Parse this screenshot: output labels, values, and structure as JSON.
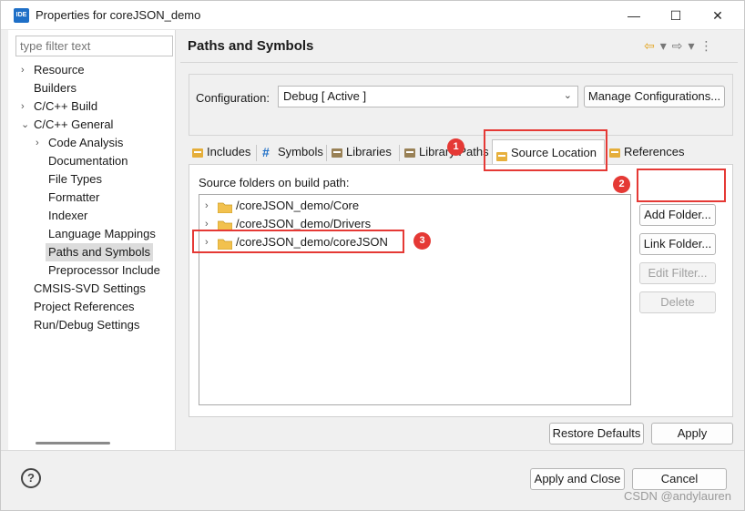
{
  "window": {
    "app_icon_text": "IDE",
    "title": "Properties for coreJSON_demo",
    "minimize": "—",
    "maximize": "☐",
    "close": "✕"
  },
  "sidebar": {
    "filter_placeholder": "type filter text",
    "items": [
      {
        "label": "Resource",
        "level": 0,
        "chevron": "›"
      },
      {
        "label": "Builders",
        "level": 0,
        "chevron": ""
      },
      {
        "label": "C/C++ Build",
        "level": 0,
        "chevron": "›"
      },
      {
        "label": "C/C++ General",
        "level": 0,
        "chevron": "⌄"
      },
      {
        "label": "Code Analysis",
        "level": 1,
        "chevron": "›"
      },
      {
        "label": "Documentation",
        "level": 1,
        "chevron": ""
      },
      {
        "label": "File Types",
        "level": 1,
        "chevron": ""
      },
      {
        "label": "Formatter",
        "level": 1,
        "chevron": ""
      },
      {
        "label": "Indexer",
        "level": 1,
        "chevron": ""
      },
      {
        "label": "Language Mappings",
        "level": 1,
        "chevron": ""
      },
      {
        "label": "Paths and Symbols",
        "level": 1,
        "chevron": "",
        "selected": true
      },
      {
        "label": "Preprocessor Include",
        "level": 1,
        "chevron": ""
      },
      {
        "label": "CMSIS-SVD Settings",
        "level": 0,
        "chevron": ""
      },
      {
        "label": "Project References",
        "level": 0,
        "chevron": ""
      },
      {
        "label": "Run/Debug Settings",
        "level": 0,
        "chevron": ""
      }
    ]
  },
  "page": {
    "title": "Paths and Symbols",
    "nav": {
      "back": "⇦",
      "dropdown": "▾",
      "forward": "⇨",
      "menu": "⋮"
    }
  },
  "configuration": {
    "label": "Configuration:",
    "value": "Debug  [ Active ]",
    "manage_button": "Manage Configurations..."
  },
  "tabs": [
    {
      "label": "Includes",
      "icon": "includes-icon"
    },
    {
      "label": "Symbols",
      "icon": "hash-icon"
    },
    {
      "label": "Libraries",
      "icon": "libraries-icon"
    },
    {
      "label": "Library Paths",
      "icon": "library-paths-icon"
    },
    {
      "label": "Source Location",
      "icon": "source-location-icon",
      "active": true
    },
    {
      "label": "References",
      "icon": "references-icon"
    }
  ],
  "source_location": {
    "label": "Source folders on build path:",
    "folders": [
      "/coreJSON_demo/Core",
      "/coreJSON_demo/Drivers",
      "/coreJSON_demo/coreJSON"
    ],
    "buttons": {
      "add_folder": "Add Folder...",
      "link_folder": "Link Folder...",
      "edit_filter": "Edit Filter...",
      "delete": "Delete"
    }
  },
  "annotations": [
    "1",
    "2",
    "3"
  ],
  "actions": {
    "restore_defaults": "Restore Defaults",
    "apply": "Apply",
    "apply_and_close": "Apply and Close",
    "cancel": "Cancel",
    "help": "?"
  },
  "watermark": "CSDN @andylauren",
  "colors": {
    "annotation_red": "#e53935",
    "accent_blue": "#1e6fc7",
    "folder_yellow": "#f2c14e"
  }
}
